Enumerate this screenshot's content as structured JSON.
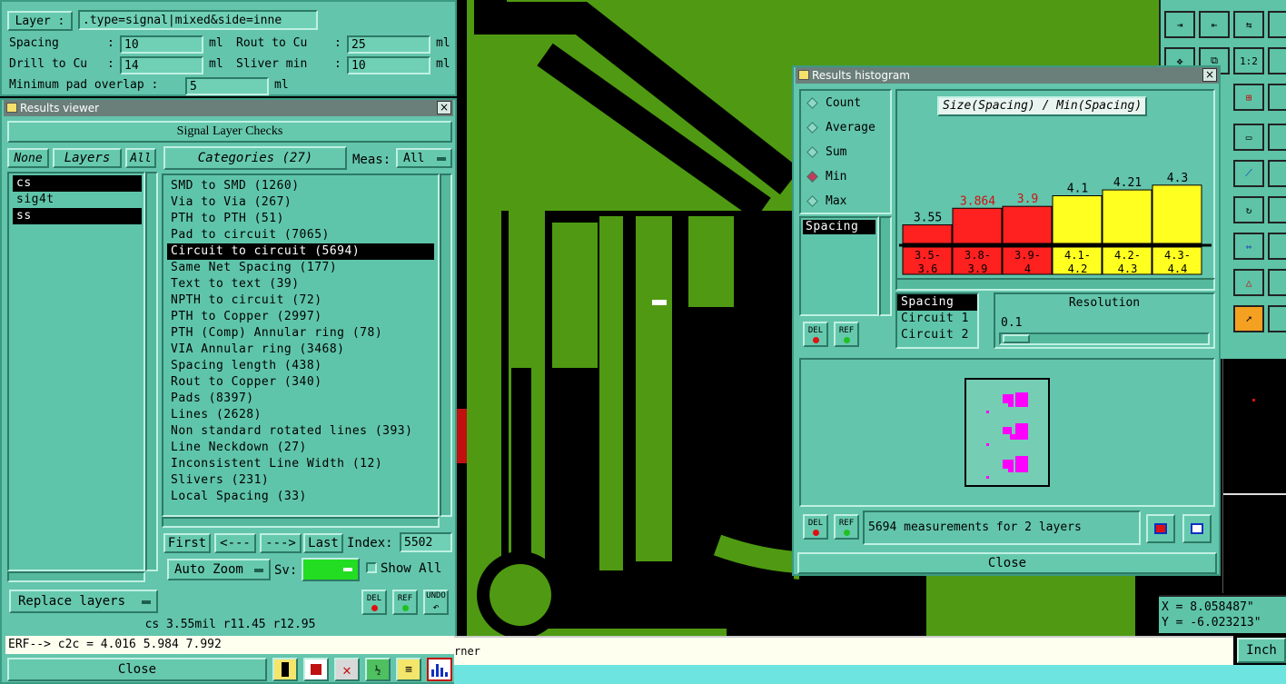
{
  "params": {
    "layer_label": "Layer :",
    "layer_value": ".type=signal|mixed&side=inne",
    "spacing_label": "Spacing",
    "spacing_value": "10",
    "rout_label": "Rout to Cu",
    "rout_value": "25",
    "drill_label": "Drill to Cu",
    "drill_value": "14",
    "sliver_label": "Sliver min",
    "sliver_value": "10",
    "pad_overlap_label": "Minimum pad overlap :",
    "pad_overlap_value": "5",
    "unit": "ml",
    "colon": ":"
  },
  "results_viewer": {
    "title": "Results viewer",
    "close_x": "×",
    "heading": "Signal Layer Checks",
    "none_label": "None",
    "layers_label": "Layers",
    "all_label": "All",
    "layers": [
      {
        "name": "cs",
        "selected": true
      },
      {
        "name": "sig4t",
        "selected": false
      },
      {
        "name": "ss",
        "selected": true
      }
    ],
    "categories_label": "Categories (27)",
    "meas_label": "Meas:",
    "meas_value": "All",
    "categories": [
      "SMD to SMD (1260)",
      "Via to Via (267)",
      "PTH to PTH (51)",
      "Pad to circuit (7065)",
      "Circuit to circuit (5694)",
      "Same Net Spacing (177)",
      "Text to text (39)",
      "NPTH to circuit (72)",
      "PTH to Copper (2997)",
      "PTH (Comp) Annular ring (78)",
      "VIA Annular ring (3468)",
      "Spacing length (438)",
      "Rout to Copper (340)",
      "Pads (8397)",
      "Lines (2628)",
      "Non standard rotated lines (393)",
      "Line Neckdown (27)",
      "Inconsistent Line Width (12)",
      "Slivers (231)",
      "Local Spacing (33)"
    ],
    "selected_category": 4,
    "first_label": "First",
    "prev_label": "<---",
    "next_label": "--->",
    "last_label": "Last",
    "index_label": "Index:",
    "index_value": "5502",
    "auto_zoom_label": "Auto Zoom",
    "sv_label": "Sv:",
    "show_all_label": "Show All",
    "replace_layers_label": "Replace layers",
    "del_label": "DEL",
    "ref_label": "REF",
    "undo_label": "UNDO",
    "status_line": "cs 3.55mil   r11.45  r12.95",
    "erf_line": "ERF--> c2c = 4.016 5.984 7.992",
    "close_label": "Close"
  },
  "histogram": {
    "title": "Results histogram",
    "close_x": "×",
    "modes": [
      {
        "label": "Count",
        "on": false
      },
      {
        "label": "Average",
        "on": false
      },
      {
        "label": "Sum",
        "on": false
      },
      {
        "label": "Min",
        "on": true
      },
      {
        "label": "Max",
        "on": false
      }
    ],
    "left_list_item": "Spacing",
    "chart_title": "Size(Spacing) / Min(Spacing)",
    "del_label": "DEL",
    "ref_label": "REF",
    "measure_list": [
      "Spacing",
      "Circuit 1",
      "Circuit 2"
    ],
    "resolution_label": "Resolution",
    "resolution_value": "0.1",
    "summary": "5694 measurements for 2 layers",
    "close_label": "Close"
  },
  "chart_data": {
    "type": "bar",
    "title": "Size(Spacing) / Min(Spacing)",
    "categories": [
      "3.5-3.6",
      "3.8-3.9",
      "3.9-4",
      "4.1-4.2",
      "4.2-4.3",
      "4.3-4.4"
    ],
    "values": [
      3.55,
      3.864,
      3.9,
      4.1,
      4.21,
      4.3
    ],
    "value_labels": [
      "3.55",
      "3.864",
      "3.9",
      "4.1",
      "4.21",
      "4.3"
    ],
    "range_labels": [
      [
        "3.5-",
        "3.6"
      ],
      [
        "3.8-",
        "3.9"
      ],
      [
        "3.9-",
        "4"
      ],
      [
        "4.1-",
        "4.2"
      ],
      [
        "4.2-",
        "4.3"
      ],
      [
        "4.3-",
        "4.4"
      ]
    ],
    "colors": [
      "#ff2020",
      "#ff2020",
      "#ff2020",
      "#ffff20",
      "#ffff20",
      "#ffff20"
    ],
    "label_colors": [
      "#000000",
      "#d01010",
      "#d01010",
      "#000000",
      "#000000",
      "#000000"
    ],
    "ylim": [
      3.2,
      4.4
    ]
  },
  "coords": {
    "x_line": "X = 8.058487\"",
    "y_line": "Y = -6.023213\""
  },
  "bottom": {
    "command_text": "rner",
    "unit_button": "Inch"
  },
  "tools": {
    "t1": "1:2"
  },
  "colors": {
    "pcb_green": "#4f9a12",
    "teal_panel": "#63c5ac",
    "selection": "#000000",
    "marker": "#ff00ff"
  }
}
